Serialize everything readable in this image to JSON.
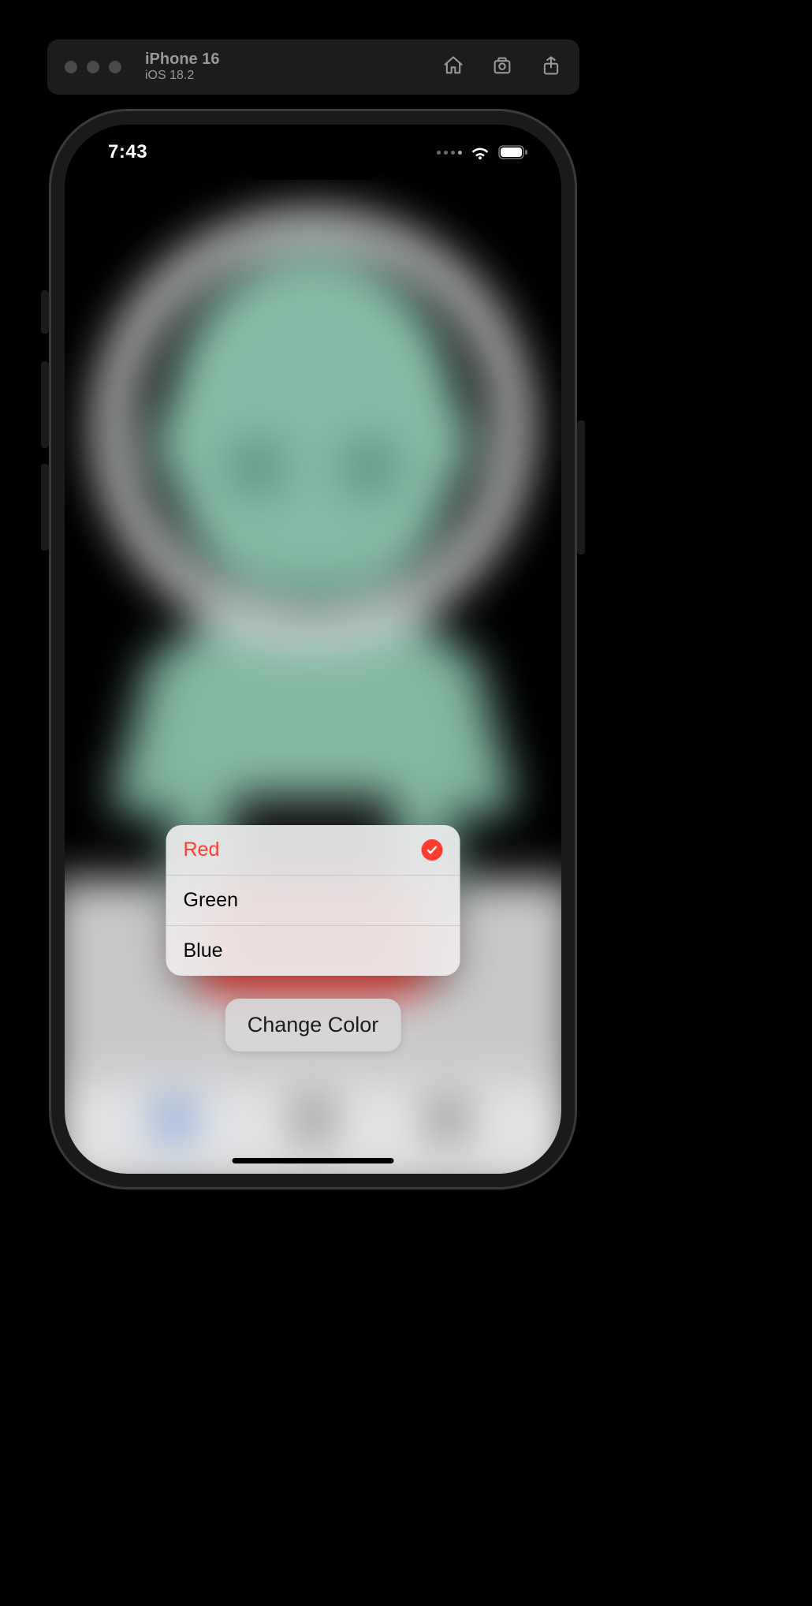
{
  "simulator": {
    "device": "iPhone 16",
    "os": "iOS 18.2"
  },
  "status": {
    "time": "7:43"
  },
  "background": {
    "character_color": "#86bca7",
    "selected_orb_color": "#ff3b30"
  },
  "menu": {
    "options": [
      {
        "label": "Red",
        "selected": true
      },
      {
        "label": "Green",
        "selected": false
      },
      {
        "label": "Blue",
        "selected": false
      }
    ]
  },
  "button": {
    "label": "Change Color"
  }
}
